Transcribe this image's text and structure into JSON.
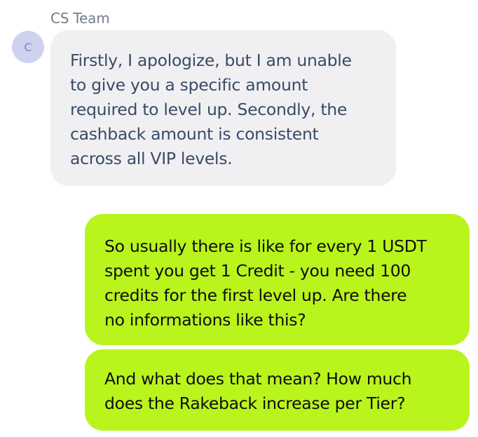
{
  "chat": {
    "sender_name": "CS Team",
    "avatar_initial": "C",
    "colors": {
      "incoming_bubble": "#f0f0f3",
      "incoming_text": "#394b66",
      "outgoing_bubble": "#b9f41c",
      "outgoing_text": "#0d0d0d",
      "avatar_bg": "#cfd2ef"
    },
    "messages": [
      {
        "direction": "incoming",
        "lines": [
          "Firstly, I apologize, but I am unable",
          "to give you a specific amount",
          "required to level up. Secondly, the",
          "cashback amount is consistent",
          "across all VIP levels."
        ]
      },
      {
        "direction": "outgoing",
        "lines": [
          "So usually there is like for every 1 USDT",
          "spent you get 1 Credit - you need 100",
          "credits for the first level up. Are there",
          "no informations like this?"
        ]
      },
      {
        "direction": "outgoing",
        "lines": [
          "And what does that mean? How much",
          "does the Rakeback increase per Tier?"
        ]
      }
    ]
  }
}
